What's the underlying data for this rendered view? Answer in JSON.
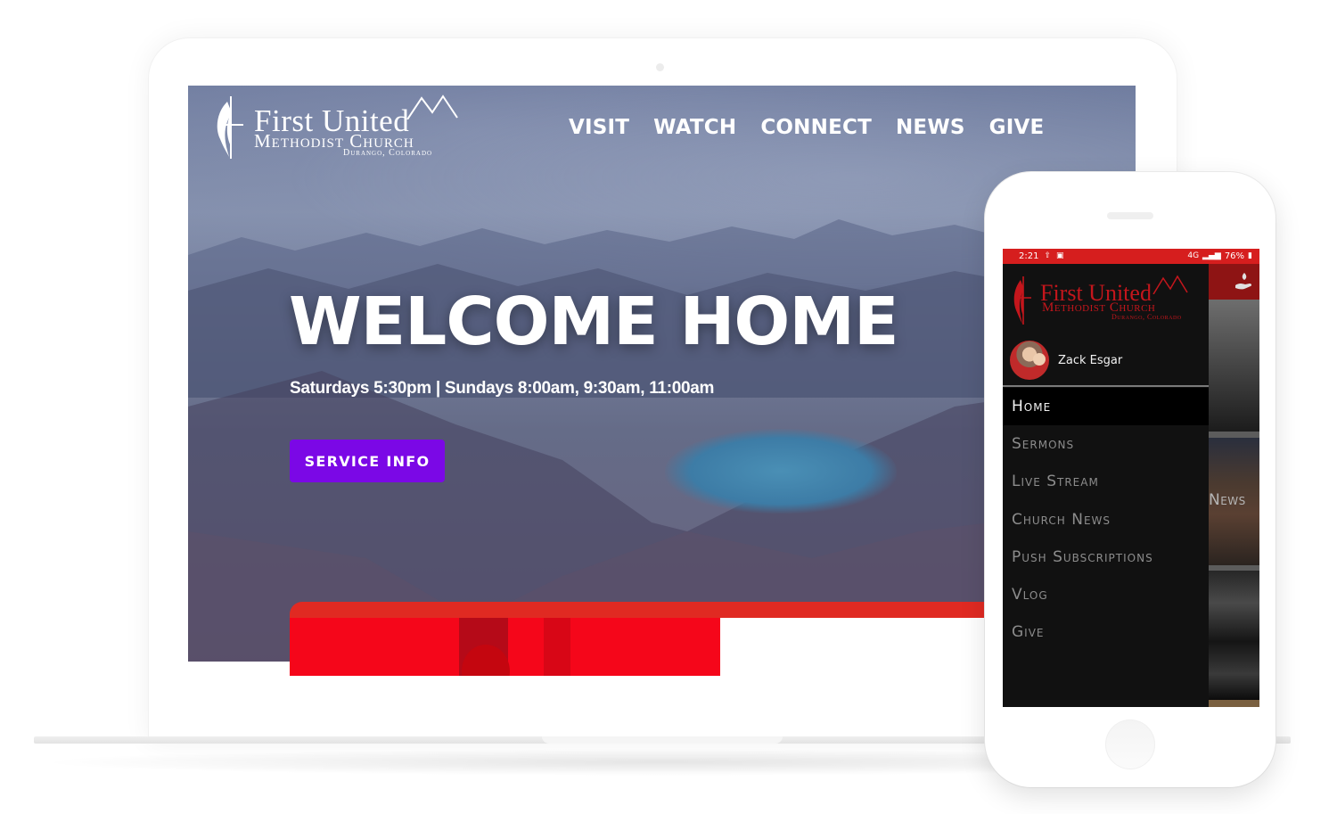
{
  "website": {
    "logo": {
      "line1": "First United",
      "line2": "Methodist Church",
      "line3": "Durango, Colorado"
    },
    "nav": [
      {
        "label": "VISIT"
      },
      {
        "label": "WATCH"
      },
      {
        "label": "CONNECT"
      },
      {
        "label": "NEWS"
      },
      {
        "label": "GIVE"
      }
    ],
    "hero": {
      "title": "WELCOME HOME",
      "subtitle": "Saturdays 5:30pm | Sundays 8:00am, 9:30am, 11:00am",
      "cta_label": "SERVICE INFO"
    },
    "colors": {
      "cta": "#7b08e6",
      "accent_red": "#e02a22"
    }
  },
  "app": {
    "status_bar": {
      "time": "2:21",
      "left_icons": [
        "upload-icon",
        "image-icon"
      ],
      "network": "4G",
      "battery": "76%"
    },
    "drawer": {
      "logo": {
        "line1": "First United",
        "line2": "Methodist Church",
        "line3": "Durango, Colorado"
      },
      "user_name": "Zack Esgar",
      "menu": [
        {
          "label": "Home",
          "active": true
        },
        {
          "label": "Sermons",
          "active": false
        },
        {
          "label": "Live Stream",
          "active": false
        },
        {
          "label": "Church News",
          "active": false
        },
        {
          "label": "Push Subscriptions",
          "active": false
        },
        {
          "label": "Vlog",
          "active": false
        },
        {
          "label": "Give",
          "active": false
        }
      ]
    },
    "background_tile_label": "News",
    "colors": {
      "status_bar": "#d61e1e",
      "brand_red": "#c4161c"
    }
  }
}
